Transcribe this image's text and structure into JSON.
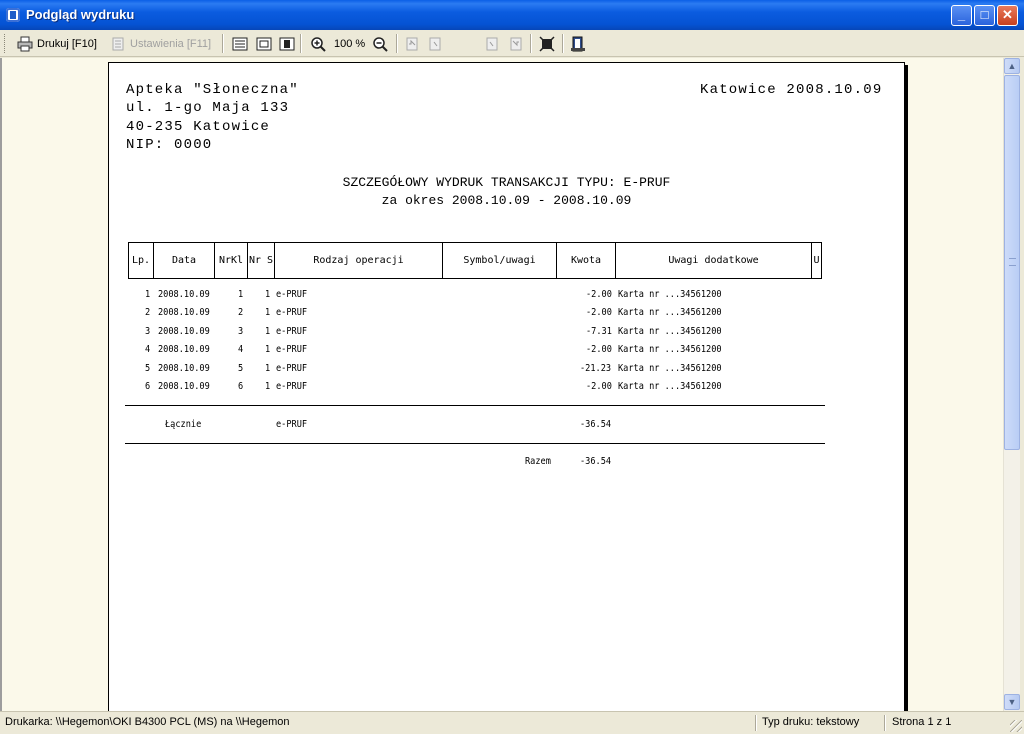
{
  "window": {
    "title": "Podgląd wydruku",
    "min_glyph": "_",
    "max_glyph": "□",
    "close_glyph": "✕"
  },
  "toolbar": {
    "print_label": "Drukuj [F10]",
    "settings_label": "Ustawienia [F11]",
    "zoom_label": "100 %",
    "page_value": "1"
  },
  "document": {
    "company_lines": [
      "Apteka \"Słoneczna\"",
      "ul. 1-go Maja 133",
      "40-235 Katowice",
      "NIP: 0000"
    ],
    "place_date": "Katowice 2008.10.09",
    "title_line1": "SZCZEGÓŁOWY WYDRUK TRANSAKCJI TYPU: E-PRUF",
    "title_line2": "za okres 2008.10.09 - 2008.10.09",
    "columns": [
      "Lp.",
      "Data",
      "NrKl",
      "Nr S",
      "Rodzaj operacji",
      "Symbol/uwagi",
      "Kwota",
      "Uwagi dodatkowe",
      "U"
    ],
    "rows": [
      {
        "lp": "1",
        "data": "2008.10.09",
        "nrkl": "1",
        "nrs": "1",
        "op": "e-PRUF",
        "kwota": "-2.00",
        "uwagi": "Karta nr ...34561200"
      },
      {
        "lp": "2",
        "data": "2008.10.09",
        "nrkl": "2",
        "nrs": "1",
        "op": "e-PRUF",
        "kwota": "-2.00",
        "uwagi": "Karta nr ...34561200"
      },
      {
        "lp": "3",
        "data": "2008.10.09",
        "nrkl": "3",
        "nrs": "1",
        "op": "e-PRUF",
        "kwota": "-7.31",
        "uwagi": "Karta nr ...34561200"
      },
      {
        "lp": "4",
        "data": "2008.10.09",
        "nrkl": "4",
        "nrs": "1",
        "op": "e-PRUF",
        "kwota": "-2.00",
        "uwagi": "Karta nr ...34561200"
      },
      {
        "lp": "5",
        "data": "2008.10.09",
        "nrkl": "5",
        "nrs": "1",
        "op": "e-PRUF",
        "kwota": "-21.23",
        "uwagi": "Karta nr ...34561200"
      },
      {
        "lp": "6",
        "data": "2008.10.09",
        "nrkl": "6",
        "nrs": "1",
        "op": "e-PRUF",
        "kwota": "-2.00",
        "uwagi": "Karta nr ...34561200"
      }
    ],
    "subtotal_label": "Łącznie",
    "subtotal_op": "e-PRUF",
    "subtotal_value": "-36.54",
    "total_label": "Razem",
    "total_value": "-36.54"
  },
  "statusbar": {
    "printer": "Drukarka: \\\\Hegemon\\OKI B4300 PCL (MS) na \\\\Hegemon",
    "print_type": "Typ druku: tekstowy",
    "page": "Strona 1 z 1"
  },
  "colors": {
    "titlebar": "#0a5fe6",
    "paper_bg": "#fbf9ea",
    "chrome": "#ece9d8"
  }
}
